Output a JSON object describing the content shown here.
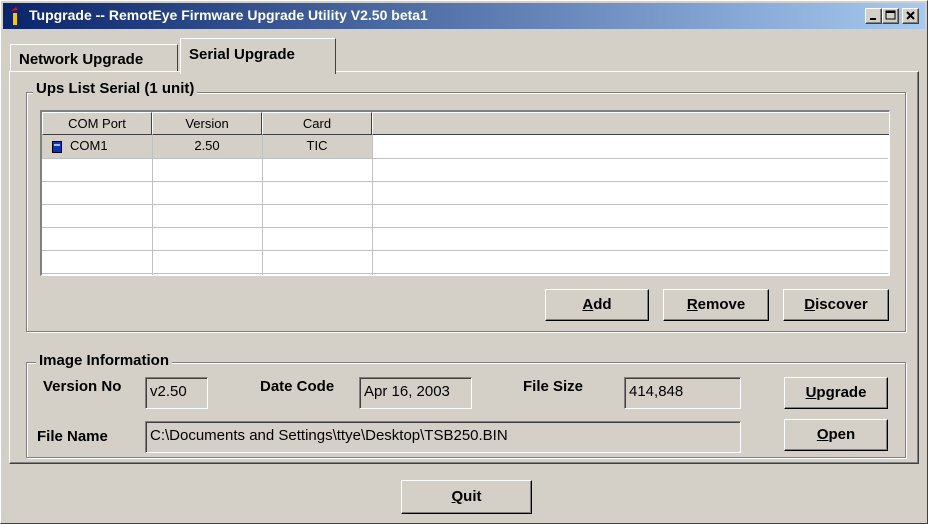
{
  "window": {
    "title": "Tupgrade -- RemotEye Firmware Upgrade Utility V2.50 beta1",
    "caption_buttons": {
      "minimize": "_",
      "maximize": "□",
      "close": "×"
    }
  },
  "tabs": [
    {
      "label": "Network Upgrade",
      "active": false
    },
    {
      "label": "Serial Upgrade",
      "active": true
    }
  ],
  "ups_list": {
    "title": "Ups List Serial (1 unit)",
    "columns": [
      "COM Port",
      "Version",
      "Card"
    ],
    "rows": [
      {
        "com_port": "COM1",
        "version": "2.50",
        "card": "TIC",
        "icon": "serial-port-icon"
      }
    ],
    "buttons": {
      "add": {
        "accel": "A",
        "rest": "dd"
      },
      "remove": {
        "accel": "R",
        "rest": "emove"
      },
      "discover": {
        "accel": "D",
        "rest": "iscover"
      }
    }
  },
  "image_info": {
    "title": "Image Information",
    "version_label": "Version No",
    "version_value": "v2.50",
    "date_label": "Date Code",
    "date_value": "Apr 16, 2003",
    "size_label": "File Size",
    "size_value": "414,848",
    "filename_label": "File Name",
    "filename_value": "C:\\Documents and Settings\\ttye\\Desktop\\TSB250.BIN",
    "upgrade": {
      "accel": "U",
      "rest": "pgrade"
    },
    "open": {
      "accel": "O",
      "rest": "pen"
    }
  },
  "quit": {
    "accel": "Q",
    "rest": "uit"
  },
  "colors": {
    "titlebar_start": "#0a246a",
    "titlebar_end": "#a6caf0",
    "face": "#d4d0c8",
    "selection": "#d4d0c8"
  }
}
